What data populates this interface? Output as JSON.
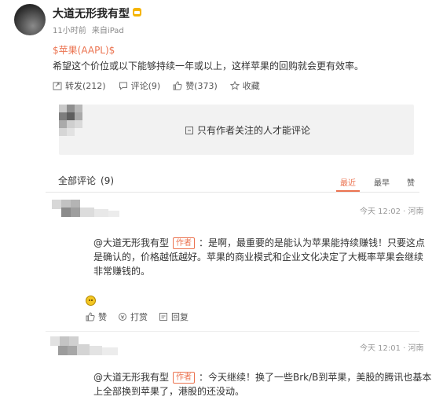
{
  "post": {
    "author": "大道无形我有型",
    "time_ago": "11小时前",
    "source": "来自iPad",
    "topic": "$苹果(AAPL)$",
    "text": "希望这个价位或以下能够持续一年或以上，这样苹果的回购就会更有效率。",
    "actions": {
      "repost": "转发(212)",
      "comment": "评论(9)",
      "like": "赞(373)",
      "favorite": "收藏"
    }
  },
  "restricted": {
    "message": "只有作者关注的人才能评论"
  },
  "comments_section": {
    "title": "全部评论",
    "count": "(9)",
    "sort_options": [
      "最近",
      "最早",
      "赞"
    ],
    "active_sort": "最近"
  },
  "comments": [
    {
      "time": "今天 12:02 · 河南",
      "reply_author": "@大道无形我有型",
      "author_tag": "作者",
      "reply_lines": [
        "：是啊，最重要的是能认为苹果能持续赚钱！只要这点",
        "是确认的，价格越低越好。苹果的商业模式和企业文化决定了大概率苹果会继续",
        "非常赚钱的。"
      ],
      "actions": {
        "like": "赞",
        "reward": "打赏",
        "reply": "回复"
      }
    },
    {
      "time": "今天 12:01 · 河南",
      "reply_author": "@大道无形我有型",
      "author_tag": "作者",
      "reply_lines": [
        "：今天继续！换了一些Brk/B到苹果，美股的腾讯也基本",
        "上全部换到苹果了，港股的还没动。"
      ]
    }
  ],
  "colors": {
    "accent": "#eb7350",
    "text": "#333333",
    "muted": "#999999",
    "restricted_bg": "#f2f2f2",
    "vip": "#f5b400"
  }
}
